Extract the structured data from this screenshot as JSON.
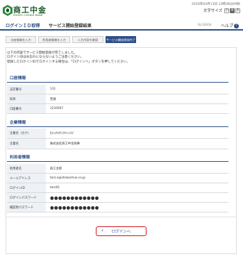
{
  "header": {
    "logo_main": "商工中金",
    "logo_sub": "SHOKO CHUKIN BANK",
    "datetime": "2016年04月13日 13時38分09秒",
    "fontsize_label": "文字サイズ",
    "fontsize_options": [
      "小",
      "中",
      "大"
    ]
  },
  "titlebar": {
    "screen_name": "ログインＩＤ取得",
    "page_title": "サービス開始登録結果",
    "screen_id": "BLGS004",
    "help_label": "ヘルプ",
    "help_icon": "?"
  },
  "steps": [
    "口座情報を入力",
    "利用者情報を入力",
    "入力内容を確認",
    "サービス開始登録完了"
  ],
  "message": [
    "以下の内容でサービス開始登録が完了しました。",
    "ログインIDはお忘れにならないようご注意ください。",
    "登録したログインIDでログインする場合は、「ログインへ」ボタンを押してください。"
  ],
  "account": {
    "heading": "口座情報",
    "rows": [
      {
        "label": "支店番号",
        "value": "131"
      },
      {
        "label": "科目",
        "value": "普通"
      },
      {
        "label": "口座番号",
        "value": "1234567"
      }
    ]
  },
  "company": {
    "heading": "企業情報",
    "rows": [
      {
        "label": "企業名（カナ）",
        "value": "ｶ)ｼｮｳｺｳﾁｭｳｷﾝｼｮｳｼﾞ"
      },
      {
        "label": "企業名",
        "value": "株式会社商工中金商事"
      }
    ]
  },
  "user": {
    "heading": "利用者情報",
    "rows": [
      {
        "label": "利用者名",
        "value": "商工太郎"
      },
      {
        "label": "メールアドレス",
        "value": "taro.s@shokochuo.co.jp"
      },
      {
        "label": "ログインID",
        "value": "taro01"
      },
      {
        "label": "ログインパスワード",
        "value": "●●●●●●●●●●●●"
      },
      {
        "label": "確認用パスワード",
        "value": "●●●●●●●●●●●●"
      }
    ]
  },
  "footer": {
    "login_button": "ログインへ"
  },
  "colors": {
    "brand_green": "#1d5a2c",
    "accent_blue": "#2c4e86",
    "highlight_red": "#d0161b"
  }
}
